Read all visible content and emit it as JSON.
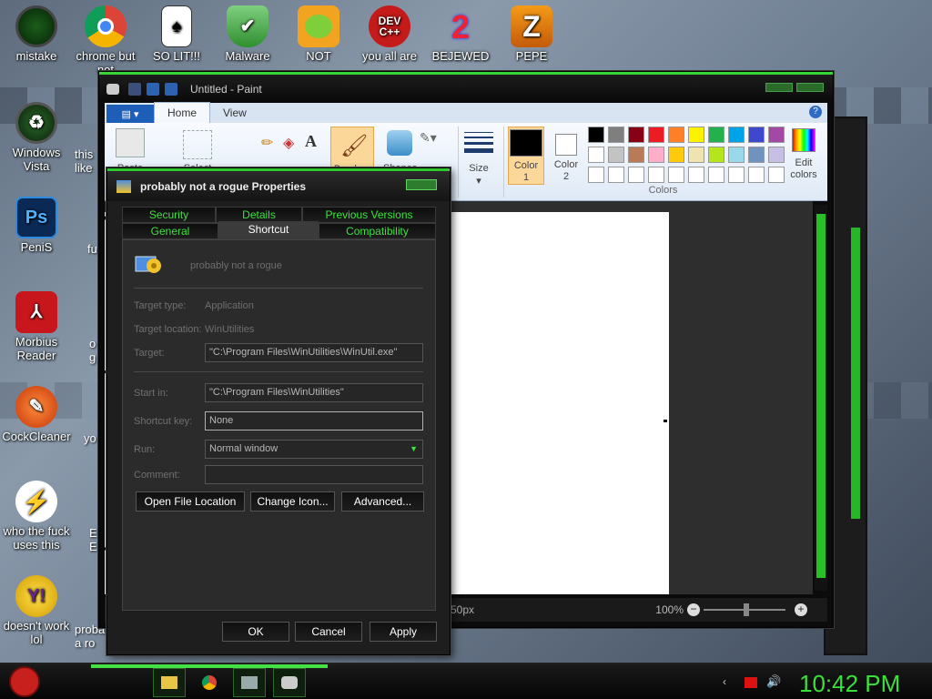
{
  "desktop": {
    "icons": [
      {
        "label": "mistake",
        "icon": "green-orb-icon"
      },
      {
        "label": "chrome but\nnot",
        "icon": "chrome-icon"
      },
      {
        "label": "SO LIT!!!",
        "icon": "cards-icon"
      },
      {
        "label": "Malware",
        "icon": "shield-icon"
      },
      {
        "label": "NOT",
        "icon": "pig-icon"
      },
      {
        "label": "you all are",
        "icon": "devcpp-icon"
      },
      {
        "label": "BEJEWED",
        "icon": "bejeweled-icon"
      },
      {
        "label": "PEPE",
        "icon": "pepe-icon"
      },
      {
        "label": "Windows\nVista",
        "icon": "recycle-icon"
      },
      {
        "label": "PeniS",
        "icon": "photoshop-icon"
      },
      {
        "label": "Morbius\nReader",
        "icon": "pdf-icon"
      },
      {
        "label": "CockCleaner",
        "icon": "ccleaner-icon"
      },
      {
        "label": "who the fuck\nuses this",
        "icon": "flash-icon"
      },
      {
        "label": "doesn't work\nlol",
        "icon": "yahoo-messenger-icon"
      }
    ],
    "partial_labels": [
      "this\nlike",
      "fu",
      "o\ng",
      "yo",
      "E\nE",
      "proba\na ro"
    ]
  },
  "paint": {
    "title": "Untitled - Paint",
    "tabs": [
      "Home",
      "View"
    ],
    "active_tab": "Home",
    "groups": {
      "size_label": "Size",
      "color1_label": "Color\n1",
      "color2_label": "Color\n2",
      "colors_label": "Colors",
      "edit_colors_label": "Edit\ncolors",
      "paste_label": "Paste",
      "select_label": "Select",
      "brushes_label": "Brushes",
      "shapes_label": "Shapes"
    },
    "palette_row1": [
      "#000000",
      "#7f7f7f",
      "#880015",
      "#ed1c24",
      "#ff7f27",
      "#fff200",
      "#22b14c",
      "#00a2e8",
      "#3f48cc",
      "#a349a4"
    ],
    "palette_row2": [
      "#ffffff",
      "#c3c3c3",
      "#b97a57",
      "#ffaec9",
      "#ffc90e",
      "#efe4b0",
      "#b5e61d",
      "#99d9ea",
      "#7092be",
      "#c8bfe7"
    ],
    "status": {
      "size": "50px",
      "zoom": "100%"
    }
  },
  "dialog": {
    "title": "probably not a rogue Properties",
    "tabs_row1": [
      "Security",
      "Details",
      "Previous Versions"
    ],
    "tabs_row2": [
      "General",
      "Shortcut",
      "Compatibility"
    ],
    "active_tab": "Shortcut",
    "name": "probably not a rogue",
    "target_type_label": "Target type:",
    "target_type": "Application",
    "target_location_label": "Target location:",
    "target_location": "WinUtilities",
    "target_label": "Target:",
    "target": "\"C:\\Program Files\\WinUtilities\\WinUtil.exe\"",
    "start_in_label": "Start in:",
    "start_in": "\"C:\\Program Files\\WinUtilities\"",
    "shortcut_key_label": "Shortcut key:",
    "shortcut_key": "None",
    "run_label": "Run:",
    "run": "Normal window",
    "comment_label": "Comment:",
    "comment": "",
    "buttons": {
      "open_location": "Open File Location",
      "change_icon": "Change Icon...",
      "advanced": "Advanced...",
      "ok": "OK",
      "cancel": "Cancel",
      "apply": "Apply"
    }
  },
  "taskbar": {
    "clock": "10:42 PM",
    "accent": "#3ae03a"
  }
}
